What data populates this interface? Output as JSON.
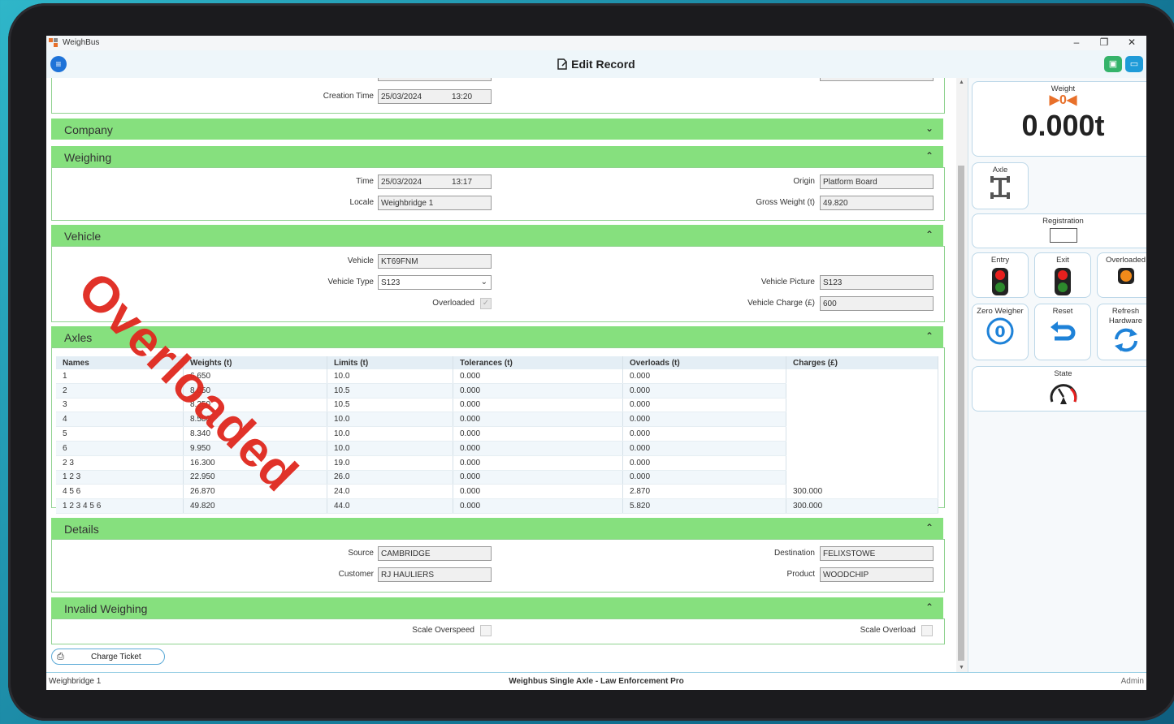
{
  "window": {
    "app_title": "WeighBus",
    "minimize": "–",
    "restore": "❐",
    "close": "✕"
  },
  "header": {
    "title": "Edit Record",
    "menu_icon": "≡",
    "right_icons": [
      "screen-icon",
      "monitor-icon"
    ]
  },
  "stamp": "Overloaded",
  "record": {
    "creation_time_label": "Creation Time",
    "creation_date": "25/03/2024",
    "creation_time": "13:20"
  },
  "sections": {
    "company": "Company",
    "weighing": "Weighing",
    "vehicle": "Vehicle",
    "axles": "Axles",
    "details": "Details",
    "invalid": "Invalid Weighing"
  },
  "weighing": {
    "time_label": "Time",
    "date": "25/03/2024",
    "time": "13:17",
    "locale_label": "Locale",
    "locale": "Weighbridge 1",
    "origin_label": "Origin",
    "origin": "Platform Board",
    "gross_label": "Gross Weight (t)",
    "gross": "49.820"
  },
  "vehicle": {
    "vehicle_label": "Vehicle",
    "vehicle": "KT69FNM",
    "type_label": "Vehicle Type",
    "type": "S123",
    "overloaded_label": "Overloaded",
    "overloaded_checked": true,
    "picture_label": "Vehicle Picture",
    "picture": "S123",
    "charge_label": "Vehicle Charge (£)",
    "charge": "600"
  },
  "axles": {
    "columns": [
      "Names",
      "Weights (t)",
      "Limits (t)",
      "Tolerances (t)",
      "Overloads (t)",
      "Charges (£)"
    ],
    "rows": [
      [
        "1",
        "6.650",
        "10.0",
        "0.000",
        "0.000",
        ""
      ],
      [
        "2",
        "8.050",
        "10.5",
        "0.000",
        "0.000",
        ""
      ],
      [
        "3",
        "8.250",
        "10.5",
        "0.000",
        "0.000",
        ""
      ],
      [
        "4",
        "8.580",
        "10.0",
        "0.000",
        "0.000",
        ""
      ],
      [
        "5",
        "8.340",
        "10.0",
        "0.000",
        "0.000",
        ""
      ],
      [
        "6",
        "9.950",
        "10.0",
        "0.000",
        "0.000",
        ""
      ],
      [
        "2 3",
        "16.300",
        "19.0",
        "0.000",
        "0.000",
        ""
      ],
      [
        "1 2 3",
        "22.950",
        "26.0",
        "0.000",
        "0.000",
        ""
      ],
      [
        "4 5 6",
        "26.870",
        "24.0",
        "0.000",
        "2.870",
        "300.000"
      ],
      [
        "1 2 3 4 5 6",
        "49.820",
        "44.0",
        "0.000",
        "5.820",
        "300.000"
      ]
    ]
  },
  "details": {
    "source_label": "Source",
    "source": "CAMBRIDGE",
    "customer_label": "Customer",
    "customer": "RJ HAULIERS",
    "destination_label": "Destination",
    "destination": "FELIXSTOWE",
    "product_label": "Product",
    "product": "WOODCHIP"
  },
  "invalid": {
    "overspeed_label": "Scale Overspeed",
    "overload_label": "Scale Overload"
  },
  "charge_ticket": "Charge Ticket",
  "side": {
    "weight_label": "Weight",
    "weight_indicator": "▶0◀",
    "weight_value": "0.000t",
    "axle_label": "Axle",
    "registration_label": "Registration",
    "entry_label": "Entry",
    "exit_label": "Exit",
    "overloaded_label": "Overloaded",
    "zero_label": "Zero Weigher",
    "reset_label": "Reset",
    "refresh_label": "Refresh Hardware",
    "state_label": "State"
  },
  "status": {
    "left": "Weighbridge 1",
    "center": "Weighbus Single Axle - Law Enforcement Pro",
    "right": "Admin"
  },
  "colors": {
    "section_green": "#86e07e",
    "accent_blue": "#1e73d8",
    "stamp_red": "#e0281e"
  }
}
